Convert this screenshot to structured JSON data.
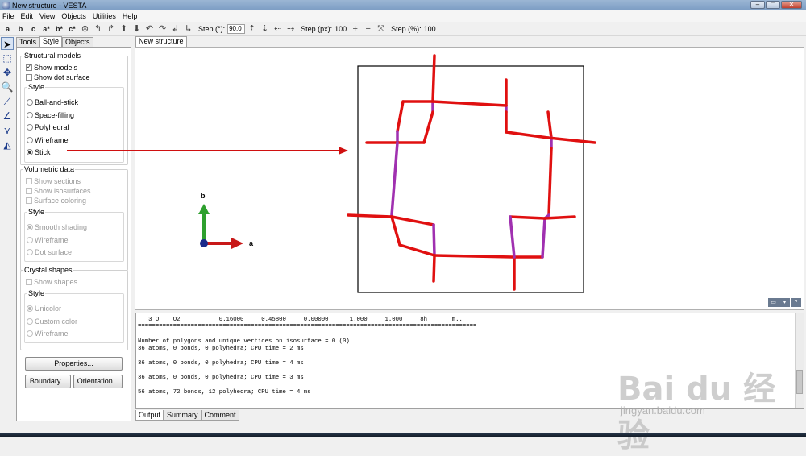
{
  "window": {
    "title": "New structure - VESTA"
  },
  "menu": [
    "File",
    "Edit",
    "View",
    "Objects",
    "Utilities",
    "Help"
  ],
  "toolbar": {
    "axis_buttons": [
      "a",
      "b",
      "c",
      "a*",
      "b*",
      "c*"
    ],
    "step_deg_label": "Step (°):",
    "step_deg_value": "90.0",
    "step_px_label": "Step (px):",
    "step_px_value": "100",
    "step_pct_label": "Step (%):",
    "step_pct_value": "100"
  },
  "panel": {
    "tabs": [
      "Tools",
      "Style",
      "Objects"
    ],
    "active_tab": "Style",
    "structural": {
      "title": "Structural models",
      "show_models": "Show models",
      "show_models_checked": true,
      "show_dot_surface": "Show dot surface",
      "style_title": "Style",
      "styles": [
        "Ball-and-stick",
        "Space-filling",
        "Polyhedral",
        "Wireframe",
        "Stick"
      ],
      "selected_style": "Stick"
    },
    "volumetric": {
      "title": "Volumetric data",
      "show_sections": "Show sections",
      "show_isosurfaces": "Show isosurfaces",
      "surface_coloring": "Surface coloring",
      "style_title": "Style",
      "styles": [
        "Smooth shading",
        "Wireframe",
        "Dot surface"
      ]
    },
    "crystal": {
      "title": "Crystal shapes",
      "show_shapes": "Show shapes",
      "style_title": "Style",
      "styles": [
        "Unicolor",
        "Custom color",
        "Wireframe"
      ]
    },
    "buttons": {
      "properties": "Properties...",
      "boundary": "Boundary...",
      "orientation": "Orientation..."
    }
  },
  "viewport": {
    "tab": "New structure",
    "axis_b": "b",
    "axis_a": "a",
    "colors": {
      "oxygen": "#e01010",
      "polyhedral_atom": "#a030b0",
      "annotation_arrow": "#d01010"
    }
  },
  "output": {
    "lines": [
      "   3 O    O2           0.16000     0.45800     0.00000      1.000     1.000     8h       m..",
      "================================================================================================",
      "",
      "Number of polygons and unique vertices on isosurface = 0 (0)",
      "36 atoms, 0 bonds, 0 polyhedra; CPU time = 2 ms",
      "",
      "36 atoms, 0 bonds, 0 polyhedra; CPU time = 4 ms",
      "",
      "36 atoms, 0 bonds, 0 polyhedra; CPU time = 3 ms",
      "",
      "56 atoms, 72 bonds, 12 polyhedra; CPU time = 4 ms"
    ],
    "tabs": [
      "Output",
      "Summary",
      "Comment"
    ]
  },
  "watermark": {
    "logo": "Bai du 经验",
    "url": "jingyan.baidu.com"
  }
}
